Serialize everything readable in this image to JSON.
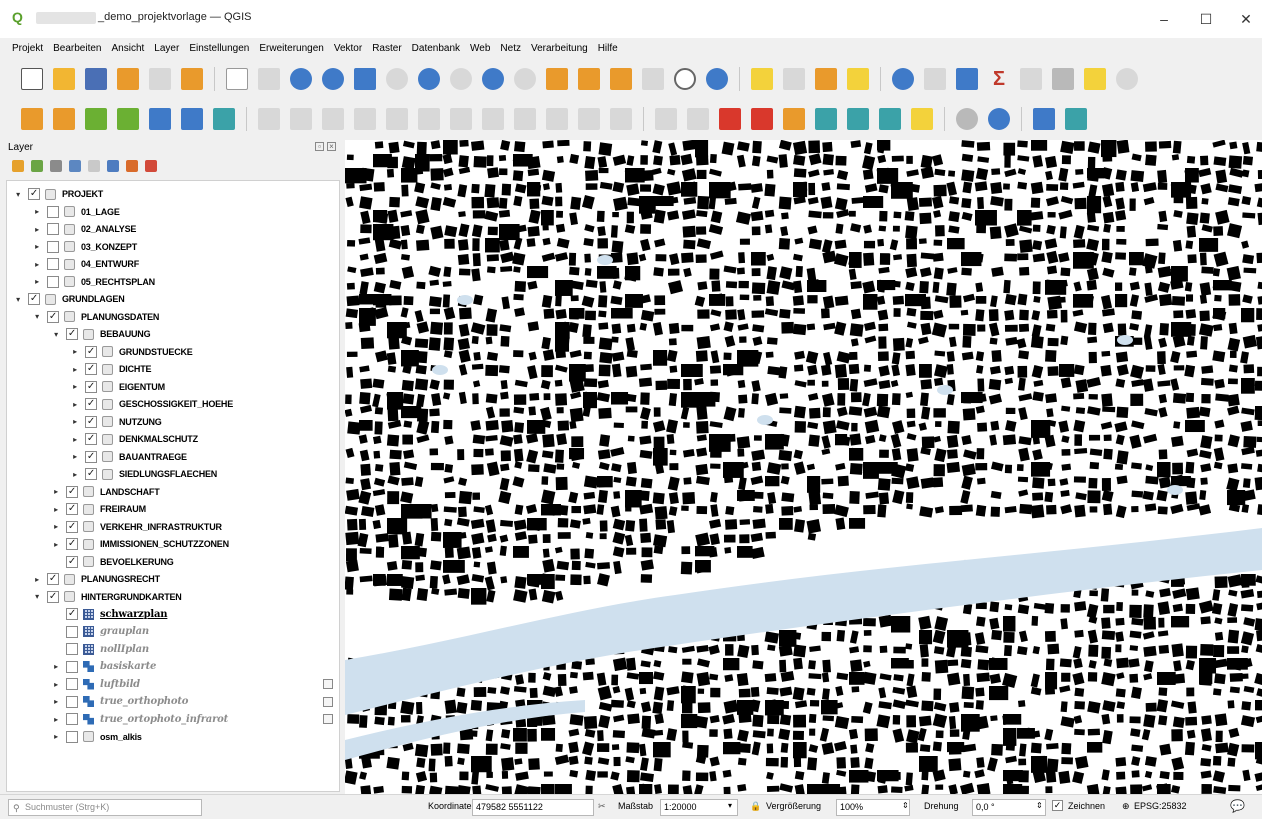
{
  "window": {
    "title": "_demo_projektvorlage — QGIS",
    "minimize": "–",
    "maximize": "☐",
    "close": "✕"
  },
  "menu": [
    "Projekt",
    "Bearbeiten",
    "Ansicht",
    "Layer",
    "Einstellungen",
    "Erweiterungen",
    "Vektor",
    "Raster",
    "Datenbank",
    "Web",
    "Netz",
    "Verarbeitung",
    "Hilfe"
  ],
  "layers_panel": {
    "title": "Layer",
    "items": [
      {
        "label": "PROJEKT",
        "checked": true,
        "expanded": true
      },
      {
        "label": "01_LAGE",
        "checked": false
      },
      {
        "label": "02_ANALYSE",
        "checked": false
      },
      {
        "label": "03_KONZEPT",
        "checked": false
      },
      {
        "label": "04_ENTWURF",
        "checked": false
      },
      {
        "label": "05_RECHTSPLAN",
        "checked": false
      },
      {
        "label": "GRUNDLAGEN",
        "checked": true,
        "expanded": true
      },
      {
        "label": "PLANUNGSDATEN",
        "checked": true,
        "expanded": true
      },
      {
        "label": "BEBAUUNG",
        "checked": true,
        "expanded": true
      },
      {
        "label": "GRUNDSTUECKE",
        "checked": true
      },
      {
        "label": "DICHTE",
        "checked": true
      },
      {
        "label": "EIGENTUM",
        "checked": true
      },
      {
        "label": "GESCHOSSIGKEIT_HOEHE",
        "checked": true
      },
      {
        "label": "NUTZUNG",
        "checked": true
      },
      {
        "label": "DENKMALSCHUTZ",
        "checked": true
      },
      {
        "label": "BAUANTRAEGE",
        "checked": true
      },
      {
        "label": "SIEDLUNGSFLAECHEN",
        "checked": true
      },
      {
        "label": "LANDSCHAFT",
        "checked": true
      },
      {
        "label": "FREIRAUM",
        "checked": true
      },
      {
        "label": "VERKEHR_INFRASTRUKTUR",
        "checked": true
      },
      {
        "label": "IMMISSIONEN_SCHUTZZONEN",
        "checked": true
      },
      {
        "label": "BEVOELKERUNG",
        "checked": true
      },
      {
        "label": "PLANUNGSRECHT",
        "checked": true
      },
      {
        "label": "HINTERGRUNDKARTEN",
        "checked": true,
        "expanded": true
      },
      {
        "label": "schwarzplan",
        "checked": true
      },
      {
        "label": "grauplan",
        "checked": false
      },
      {
        "label": "nollIplan",
        "checked": false
      },
      {
        "label": "basiskarte",
        "checked": false
      },
      {
        "label": "luftbild",
        "checked": false
      },
      {
        "label": "true_orthophoto",
        "checked": false
      },
      {
        "label": "true_ortophoto_infrarot",
        "checked": false
      },
      {
        "label": "osm_alkis",
        "checked": false
      }
    ]
  },
  "statusbar": {
    "search_placeholder": "Suchmuster (Strg+K)",
    "coord_label": "Koordinate",
    "coord_value": "479582 5551122",
    "scale_label": "Maßstab",
    "scale_value": "1:20000",
    "magnifier_label": "Vergrößerung",
    "magnifier_value": "100%",
    "rotation_label": "Drehung",
    "rotation_value": "0,0 °",
    "render_label": "Zeichnen",
    "render_checked": true,
    "crs": "EPSG:25832"
  },
  "colors": {
    "map_buildings": "#000000",
    "map_water": "#cfe0ee",
    "map_background": "#ffffff"
  }
}
